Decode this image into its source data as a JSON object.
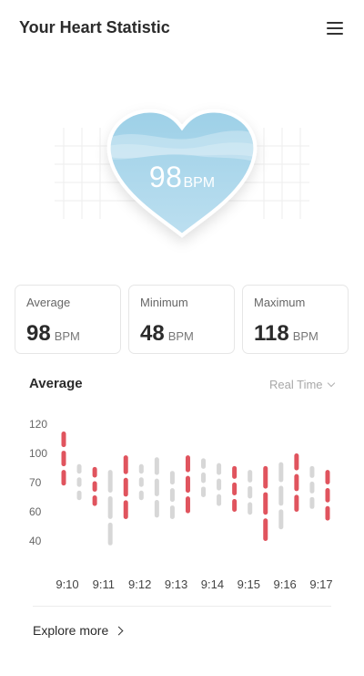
{
  "header": {
    "title": "Your Heart Statistic",
    "menu_icon": "hamburger-menu-icon"
  },
  "heart": {
    "value": "98",
    "unit": "BPM"
  },
  "stats": [
    {
      "label": "Average",
      "value": "98",
      "unit": "BPM"
    },
    {
      "label": "Minimum",
      "value": "48",
      "unit": "BPM"
    },
    {
      "label": "Maximum",
      "value": "118",
      "unit": "BPM"
    }
  ],
  "section": {
    "title": "Average",
    "range_select": "Real Time"
  },
  "chart_data": {
    "type": "bar",
    "description_kind": "floating range bars",
    "y_ticks": [
      "120",
      "100",
      "70",
      "60",
      "40"
    ],
    "x_ticks": [
      "9:10",
      "9:11",
      "9:12",
      "9:13",
      "9:14",
      "9:15",
      "9:16",
      "9:17"
    ],
    "colors": {
      "highlight": "#e0545e",
      "normal": "#d7d7d7"
    },
    "bars": [
      {
        "low": 69,
        "high": 115,
        "highlight": true
      },
      {
        "low": 64,
        "high": 89,
        "highlight": false
      },
      {
        "low": 62,
        "high": 86,
        "highlight": true
      },
      {
        "low": 37,
        "high": 83,
        "highlight": false
      },
      {
        "low": 55,
        "high": 98,
        "highlight": true
      },
      {
        "low": 64,
        "high": 89,
        "highlight": false
      },
      {
        "low": 56,
        "high": 96,
        "highlight": false
      },
      {
        "low": 55,
        "high": 82,
        "highlight": false
      },
      {
        "low": 59,
        "high": 98,
        "highlight": true
      },
      {
        "low": 65,
        "high": 95,
        "highlight": false
      },
      {
        "low": 62,
        "high": 90,
        "highlight": false
      },
      {
        "low": 60,
        "high": 87,
        "highlight": true
      },
      {
        "low": 58,
        "high": 83,
        "highlight": false
      },
      {
        "low": 40,
        "high": 87,
        "highlight": true
      },
      {
        "low": 48,
        "high": 91,
        "highlight": false
      },
      {
        "low": 60,
        "high": 100,
        "highlight": true
      },
      {
        "low": 61,
        "high": 87,
        "highlight": false
      },
      {
        "low": 54,
        "high": 83,
        "highlight": true
      }
    ]
  },
  "footer": {
    "link": "Explore more"
  }
}
